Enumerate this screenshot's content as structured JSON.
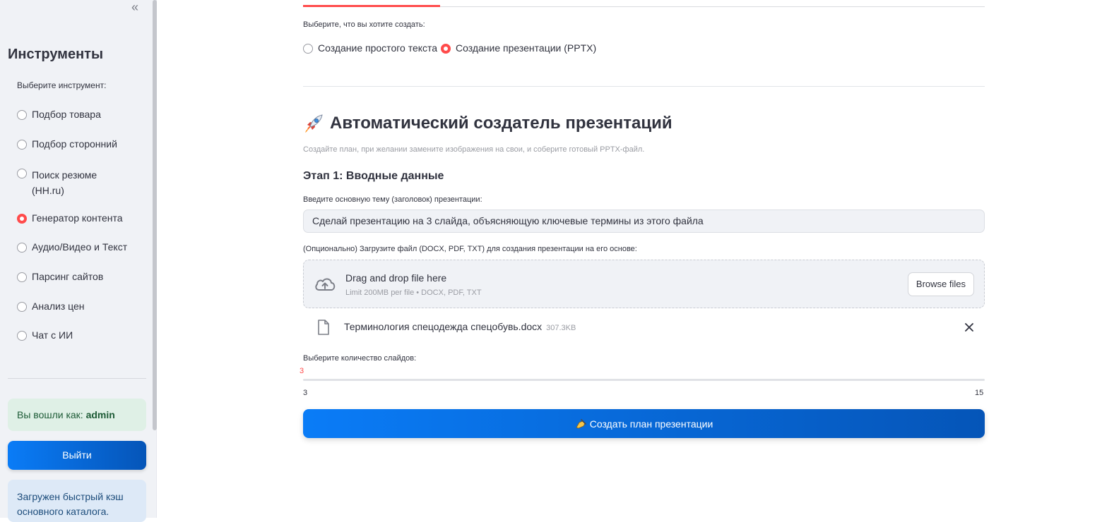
{
  "sidebar": {
    "collapse_glyph": "«",
    "title": "Инструменты",
    "select_label": "Выберите инструмент:",
    "items": [
      {
        "label": "Подбор товара",
        "selected": false
      },
      {
        "label": "Подбор сторонний",
        "selected": false
      },
      {
        "label": "Поиск резюме",
        "label2": "(HH.ru)",
        "selected": false
      },
      {
        "label": "Генератор контента",
        "selected": true
      },
      {
        "label": "Аудио/Видео и Текст",
        "selected": false
      },
      {
        "label": "Парсинг сайтов",
        "selected": false
      },
      {
        "label": "Анализ цен",
        "selected": false
      },
      {
        "label": "Чат с ИИ",
        "selected": false
      }
    ],
    "login_prefix": "Вы вошли как:",
    "login_user": "admin",
    "logout_label": "Выйти",
    "info_text": "Загружен быстрый кэш основного каталога."
  },
  "main": {
    "mode_label": "Выберите, что вы хотите создать:",
    "modes": [
      {
        "label": "Создание простого текста",
        "selected": false
      },
      {
        "label": "Создание презентации (PPTX)",
        "selected": true
      }
    ],
    "heading": "Автоматический создатель презентаций",
    "caption": "Создайте план, при желании замените изображения на свои, и соберите готовый PPTX-файл.",
    "stage": "Этап 1: Вводные данные",
    "topic_label": "Введите основную тему (заголовок) презентации:",
    "topic_value": "Сделай презентацию на 3 слайда, объясняющую ключевые термины из этого файла",
    "upload_label": "(Опционально) Загрузите файл (DOCX, PDF, TXT) для создания презентации на его основе:",
    "dropzone_title": "Drag and drop file here",
    "dropzone_sub": "Limit 200MB per file • DOCX, PDF, TXT",
    "browse_label": "Browse files",
    "file_name": "Терминология спецодежда спецобувь.docx",
    "file_size": "307.3KB",
    "slides_label": "Выберите количество слайдов:",
    "slider_value": "3",
    "slider_min": "3",
    "slider_max": "15",
    "cta_label": "Создать план презентации"
  },
  "colors": {
    "accent": "#ff4b4b",
    "primary": "#0a7cf7",
    "primary_dark": "#0555b8"
  }
}
